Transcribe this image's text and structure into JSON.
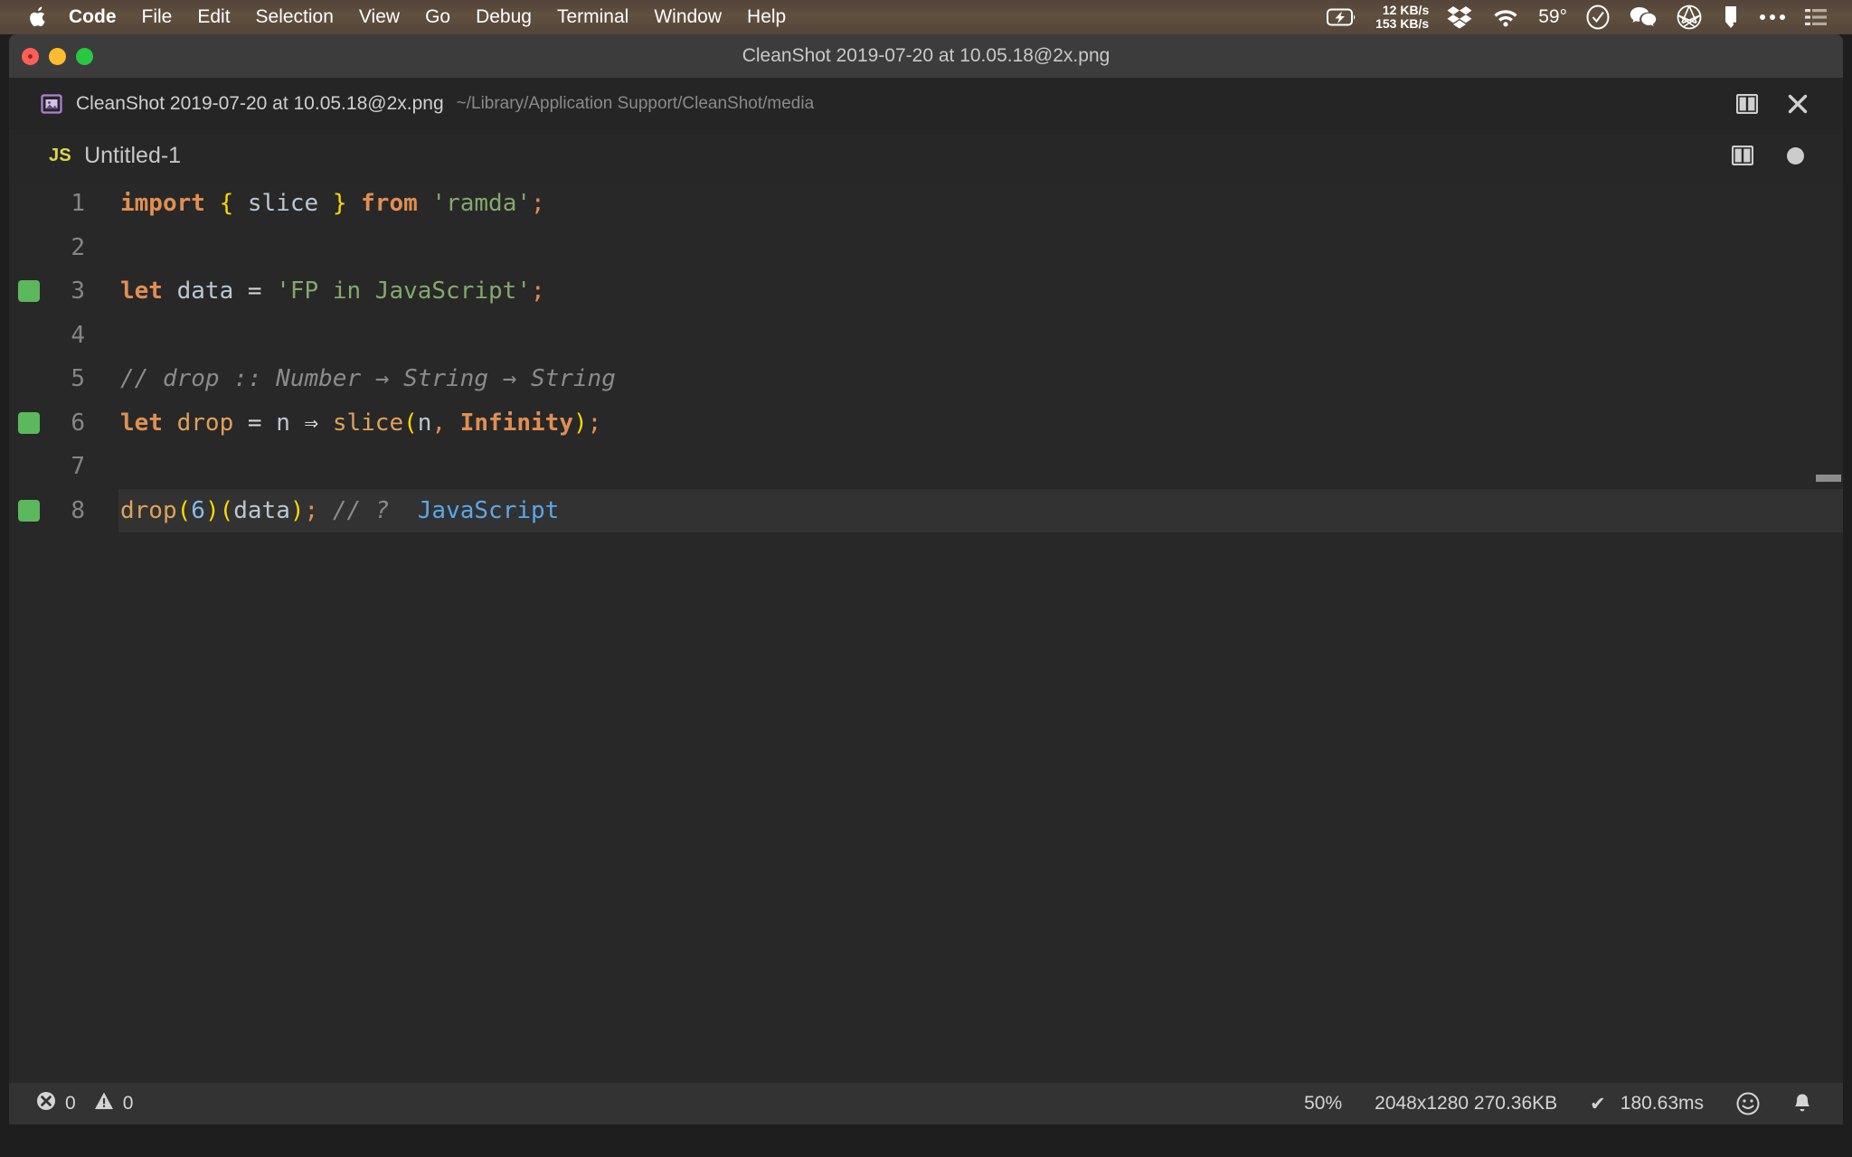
{
  "menubar": {
    "apple_icon": "apple-logo-icon",
    "items": [
      {
        "label": "Code",
        "bold": true
      },
      {
        "label": "File",
        "bold": false
      },
      {
        "label": "Edit",
        "bold": false
      },
      {
        "label": "Selection",
        "bold": false
      },
      {
        "label": "View",
        "bold": false
      },
      {
        "label": "Go",
        "bold": false
      },
      {
        "label": "Debug",
        "bold": false
      },
      {
        "label": "Terminal",
        "bold": false
      },
      {
        "label": "Window",
        "bold": false
      },
      {
        "label": "Help",
        "bold": false
      }
    ],
    "status": {
      "battery_icon": "battery-charging-icon",
      "network_down": "12 KB/s",
      "network_up": "153 KB/s",
      "dropbox_icon": "dropbox-icon",
      "wifi_icon": "wifi-icon",
      "temperature": "59°",
      "clock_icon": "clock-check-icon",
      "wechat_icon": "wechat-icon",
      "aperture_icon": "aperture-icon",
      "cleanshot_icon": "cleanshot-icon",
      "more_icon": "ellipsis-icon",
      "controlcenter_icon": "list-menu-icon"
    }
  },
  "window": {
    "title": "CleanShot 2019-07-20 at 10.05.18@2x.png",
    "traffic_lights": [
      "close",
      "minimize",
      "zoom"
    ]
  },
  "filebar": {
    "icon": "image-file-icon",
    "name": "CleanShot 2019-07-20 at 10.05.18@2x.png",
    "path": "~/Library/Application Support/CleanShot/media",
    "split_icon": "split-editor-icon",
    "close_icon": "close-icon"
  },
  "tabrow": {
    "lang_badge": "JS",
    "title": "Untitled-1",
    "split_icon": "split-editor-icon",
    "dirty_icon": "unsaved-dot-icon"
  },
  "editor": {
    "language": "javascript",
    "lines": [
      {
        "number": "1",
        "modified": false,
        "active": false,
        "tokens": [
          {
            "text": "import",
            "cls": "t-kw"
          },
          {
            "text": " ",
            "cls": "t-plain"
          },
          {
            "text": "{",
            "cls": "t-brace"
          },
          {
            "text": " ",
            "cls": "t-plain"
          },
          {
            "text": "slice",
            "cls": "t-var"
          },
          {
            "text": " ",
            "cls": "t-plain"
          },
          {
            "text": "}",
            "cls": "t-brace"
          },
          {
            "text": " ",
            "cls": "t-plain"
          },
          {
            "text": "from",
            "cls": "t-kw"
          },
          {
            "text": " ",
            "cls": "t-plain"
          },
          {
            "text": "'ramda'",
            "cls": "t-str"
          },
          {
            "text": ";",
            "cls": "t-semi"
          }
        ]
      },
      {
        "number": "2",
        "modified": false,
        "active": false,
        "tokens": []
      },
      {
        "number": "3",
        "modified": true,
        "active": false,
        "tokens": [
          {
            "text": "let",
            "cls": "t-kw"
          },
          {
            "text": " ",
            "cls": "t-plain"
          },
          {
            "text": "data",
            "cls": "t-var"
          },
          {
            "text": " ",
            "cls": "t-plain"
          },
          {
            "text": "=",
            "cls": "t-plain"
          },
          {
            "text": " ",
            "cls": "t-plain"
          },
          {
            "text": "'FP in JavaScript'",
            "cls": "t-str"
          },
          {
            "text": ";",
            "cls": "t-semi"
          }
        ]
      },
      {
        "number": "4",
        "modified": false,
        "active": false,
        "tokens": []
      },
      {
        "number": "5",
        "modified": false,
        "active": false,
        "tokens": [
          {
            "text": "// drop :: Number → String → String",
            "cls": "t-comment"
          }
        ]
      },
      {
        "number": "6",
        "modified": true,
        "active": false,
        "tokens": [
          {
            "text": "let",
            "cls": "t-kw"
          },
          {
            "text": " ",
            "cls": "t-plain"
          },
          {
            "text": "drop",
            "cls": "t-fn"
          },
          {
            "text": " ",
            "cls": "t-plain"
          },
          {
            "text": "=",
            "cls": "t-plain"
          },
          {
            "text": " ",
            "cls": "t-plain"
          },
          {
            "text": "n",
            "cls": "t-var"
          },
          {
            "text": " ",
            "cls": "t-plain"
          },
          {
            "text": "⇒",
            "cls": "t-plain"
          },
          {
            "text": " ",
            "cls": "t-plain"
          },
          {
            "text": "slice",
            "cls": "t-fn"
          },
          {
            "text": "(",
            "cls": "t-brace"
          },
          {
            "text": "n",
            "cls": "t-var"
          },
          {
            "text": ",",
            "cls": "t-semi"
          },
          {
            "text": " ",
            "cls": "t-plain"
          },
          {
            "text": "Infinity",
            "cls": "t-const"
          },
          {
            "text": ")",
            "cls": "t-brace"
          },
          {
            "text": ";",
            "cls": "t-semi"
          }
        ]
      },
      {
        "number": "7",
        "modified": false,
        "active": false,
        "tokens": []
      },
      {
        "number": "8",
        "modified": true,
        "active": true,
        "tokens": [
          {
            "text": "drop",
            "cls": "t-fn"
          },
          {
            "text": "(",
            "cls": "t-brace"
          },
          {
            "text": "6",
            "cls": "t-num"
          },
          {
            "text": ")",
            "cls": "t-brace"
          },
          {
            "text": "(",
            "cls": "t-brace"
          },
          {
            "text": "data",
            "cls": "t-var"
          },
          {
            "text": ")",
            "cls": "t-brace"
          },
          {
            "text": ";",
            "cls": "t-semi"
          },
          {
            "text": " ",
            "cls": "t-plain"
          },
          {
            "text": "// ?",
            "cls": "t-comment"
          },
          {
            "text": "  ",
            "cls": "t-plain"
          },
          {
            "text": "JavaScript",
            "cls": "t-blue"
          }
        ]
      }
    ],
    "overview_marks": [
      {
        "top_pct": 32.5
      }
    ]
  },
  "statusbar": {
    "error_icon": "error-circle-icon",
    "error_count": "0",
    "warning_icon": "warning-triangle-icon",
    "warning_count": "0",
    "zoom": "50%",
    "image_info": "2048x1280 270.36KB",
    "timing_check": "✔",
    "timing": "180.63ms",
    "feedback_icon": "smiley-icon",
    "bell_icon": "bell-icon"
  },
  "colors": {
    "menubar_bg": "#5a4a3c",
    "titlebar_bg": "#3c3c3c",
    "editor_bg": "#282828",
    "statusbar_bg": "#333333",
    "modified_marker": "#5cb85c",
    "js_badge": "#d9d94a",
    "keyword": "#e08f52",
    "string": "#83a96b",
    "brace": "#ffd700",
    "comment": "#8b8b8b",
    "number": "#87b9e8"
  }
}
